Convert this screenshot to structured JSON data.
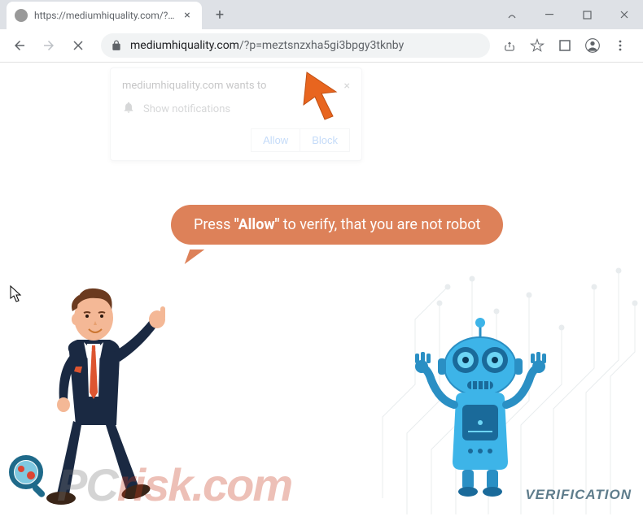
{
  "tab": {
    "title": "https://mediumhiquality.com/?p=",
    "close_label": "×",
    "new_tab_label": "+"
  },
  "address": {
    "host": "mediumhiquality.com",
    "path": "/?p=meztsnzxha5gi3bpgy3tknby"
  },
  "notification": {
    "title": "mediumhiquality.com wants to",
    "permission": "Show notifications",
    "allow": "Allow",
    "block": "Block"
  },
  "speech": {
    "prefix": "Press ",
    "bold": "\"Allow\"",
    "suffix": " to verify, that you are not robot"
  },
  "verification_label": "VERIFICATION",
  "watermark": {
    "part1": "PC",
    "part2": "risk.com"
  }
}
